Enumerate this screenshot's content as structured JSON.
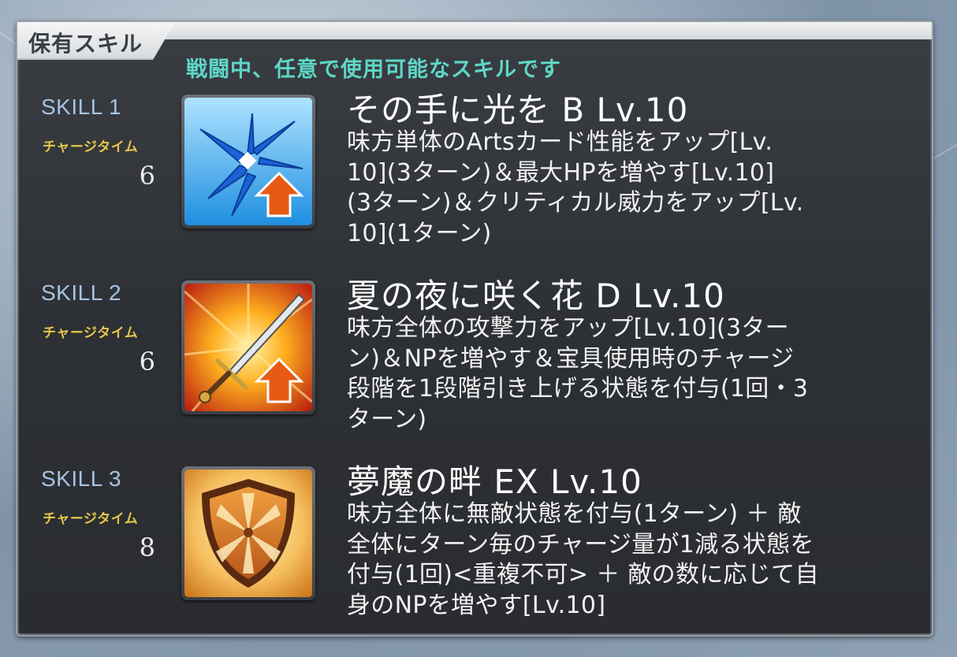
{
  "header": {
    "title": "保有スキル",
    "subtitle": "戦闘中、任意で使用可能なスキルです"
  },
  "skills": [
    {
      "label": "SKILL 1",
      "charge_label": "チャージタイム",
      "charge": "6",
      "name": "その手に光を B Lv.10",
      "desc_lines": [
        "味方単体のArtsカード性能をアップ[Lv.",
        "10](3ターン)＆最大HPを増やす[Lv.10]",
        "(3ターン)＆クリティカル威力をアップ[Lv.",
        "10](1ターン)"
      ],
      "icon": "arts-burst-up-icon"
    },
    {
      "label": "SKILL 2",
      "charge_label": "チャージタイム",
      "charge": "6",
      "name": "夏の夜に咲く花 D Lv.10",
      "desc_lines": [
        "味方全体の攻撃力をアップ[Lv.10](3ター",
        "ン)＆NPを増やす＆宝具使用時のチャージ",
        "段階を1段階引き上げる状態を付与(1回・3",
        "ターン)"
      ],
      "icon": "sword-attack-up-icon"
    },
    {
      "label": "SKILL 3",
      "charge_label": "チャージタイム",
      "charge": "8",
      "name": "夢魔の畔 EX Lv.10",
      "desc_lines": [
        "味方全体に無敵状態を付与(1ターン) ＋ 敵",
        "全体にターン毎のチャージ量が1減る状態を",
        "付与(1回)<重複不可> ＋ 敵の数に応じて自",
        "身のNPを増やす[Lv.10]"
      ],
      "icon": "shield-invincible-icon"
    }
  ],
  "colors": {
    "accent_teal": "#5fd7c8",
    "skill_label": "#a7c3e3",
    "charge_label": "#e6c74a"
  }
}
